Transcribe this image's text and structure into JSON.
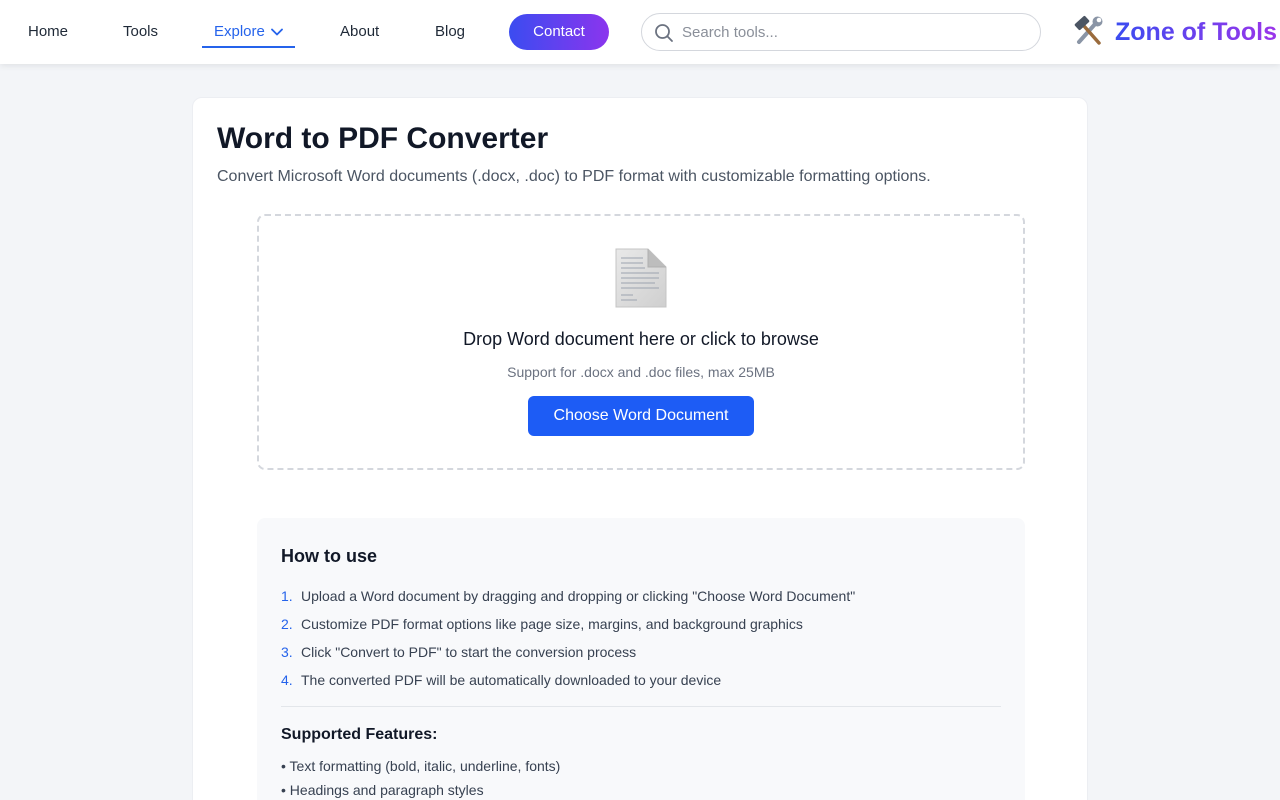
{
  "nav": {
    "items": [
      {
        "label": "Home"
      },
      {
        "label": "Tools"
      },
      {
        "label": "Explore"
      },
      {
        "label": "About"
      },
      {
        "label": "Blog"
      }
    ],
    "active": "Explore",
    "contact_label": "Contact"
  },
  "search": {
    "placeholder": "Search tools...",
    "value": ""
  },
  "brand": {
    "name": "Zone of Tools",
    "icon": "hammer-wrench-icon"
  },
  "colors": {
    "accent": "#2563eb",
    "button": "#1d5cf5",
    "gradient_start": "#3b4cf0",
    "gradient_end": "#8b35ee"
  },
  "main": {
    "title": "Word to PDF Converter",
    "subtitle": "Convert Microsoft Word documents (.docx, .doc) to PDF format with customizable formatting options.",
    "dropzone": {
      "icon": "document-icon",
      "title": "Drop Word document here or click to browse",
      "subtitle": "Support for .docx and .doc files, max 25MB",
      "button_label": "Choose Word Document"
    },
    "howto": {
      "title": "How to use",
      "steps": [
        {
          "num": "1.",
          "text": "Upload a Word document by dragging and dropping or clicking \"Choose Word Document\""
        },
        {
          "num": "2.",
          "text": "Customize PDF format options like page size, margins, and background graphics"
        },
        {
          "num": "3.",
          "text": "Click \"Convert to PDF\" to start the conversion process"
        },
        {
          "num": "4.",
          "text": "The converted PDF will be automatically downloaded to your device"
        }
      ],
      "features_title": "Supported Features:",
      "features": [
        "• Text formatting (bold, italic, underline, fonts)",
        "• Headings and paragraph styles"
      ]
    }
  }
}
